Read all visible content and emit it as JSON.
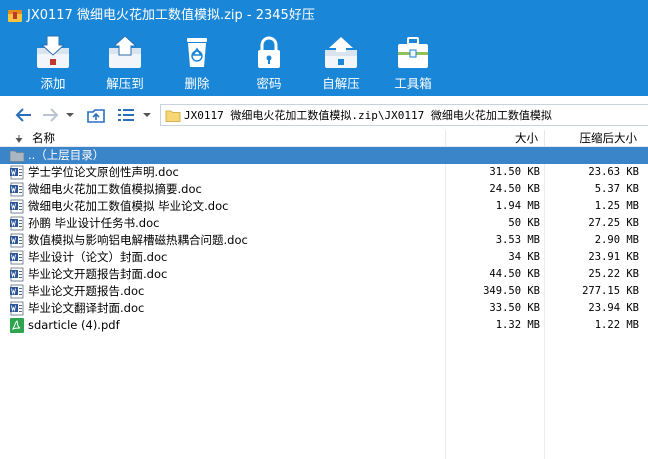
{
  "window": {
    "title": "JX0117 微细电火花加工数值模拟.zip - 2345好压"
  },
  "toolbar": [
    {
      "label": "添加",
      "icon": "add-archive-icon"
    },
    {
      "label": "解压到",
      "icon": "extract-to-icon"
    },
    {
      "label": "删除",
      "icon": "recycle-bin-icon"
    },
    {
      "label": "密码",
      "icon": "lock-icon"
    },
    {
      "label": "自解压",
      "icon": "self-extract-icon"
    },
    {
      "label": "工具箱",
      "icon": "toolbox-icon"
    }
  ],
  "navigation": {
    "address": "JX0117 微细电火花加工数值模拟.zip\\JX0117 微细电火花加工数值模拟"
  },
  "columns": {
    "name": "名称",
    "size": "大小",
    "compressed": "压缩后大小"
  },
  "parent_row": {
    "label": "..（上层目录）"
  },
  "files": [
    {
      "name": "学士学位论文原创性声明.doc",
      "size": "31.50 KB",
      "compressed": "23.63 KB",
      "type": "doc"
    },
    {
      "name": "微细电火花加工数值模拟摘要.doc",
      "size": "24.50 KB",
      "compressed": "5.37 KB",
      "type": "doc"
    },
    {
      "name": "微细电火花加工数值模拟 毕业论文.doc",
      "size": "1.94 MB",
      "compressed": "1.25 MB",
      "type": "doc"
    },
    {
      "name": "孙鹏  毕业设计任务书.doc",
      "size": "50 KB",
      "compressed": "27.25 KB",
      "type": "doc"
    },
    {
      "name": "数值模拟与影响铝电解槽磁热耦合问题.doc",
      "size": "3.53 MB",
      "compressed": "2.90 MB",
      "type": "doc"
    },
    {
      "name": "毕业设计（论文）封面.doc",
      "size": "34 KB",
      "compressed": "23.91 KB",
      "type": "doc"
    },
    {
      "name": "毕业论文开题报告封面.doc",
      "size": "44.50 KB",
      "compressed": "25.22 KB",
      "type": "doc"
    },
    {
      "name": "毕业论文开题报告.doc",
      "size": "349.50 KB",
      "compressed": "277.15 KB",
      "type": "doc"
    },
    {
      "name": "毕业论文翻译封面.doc",
      "size": "33.50 KB",
      "compressed": "23.94 KB",
      "type": "doc"
    },
    {
      "name": "sdarticle (4).pdf",
      "size": "1.32 MB",
      "compressed": "1.22 MB",
      "type": "pdf"
    }
  ],
  "colors": {
    "title_blue": "#1a86d8",
    "selection_blue": "#3a84c9"
  }
}
